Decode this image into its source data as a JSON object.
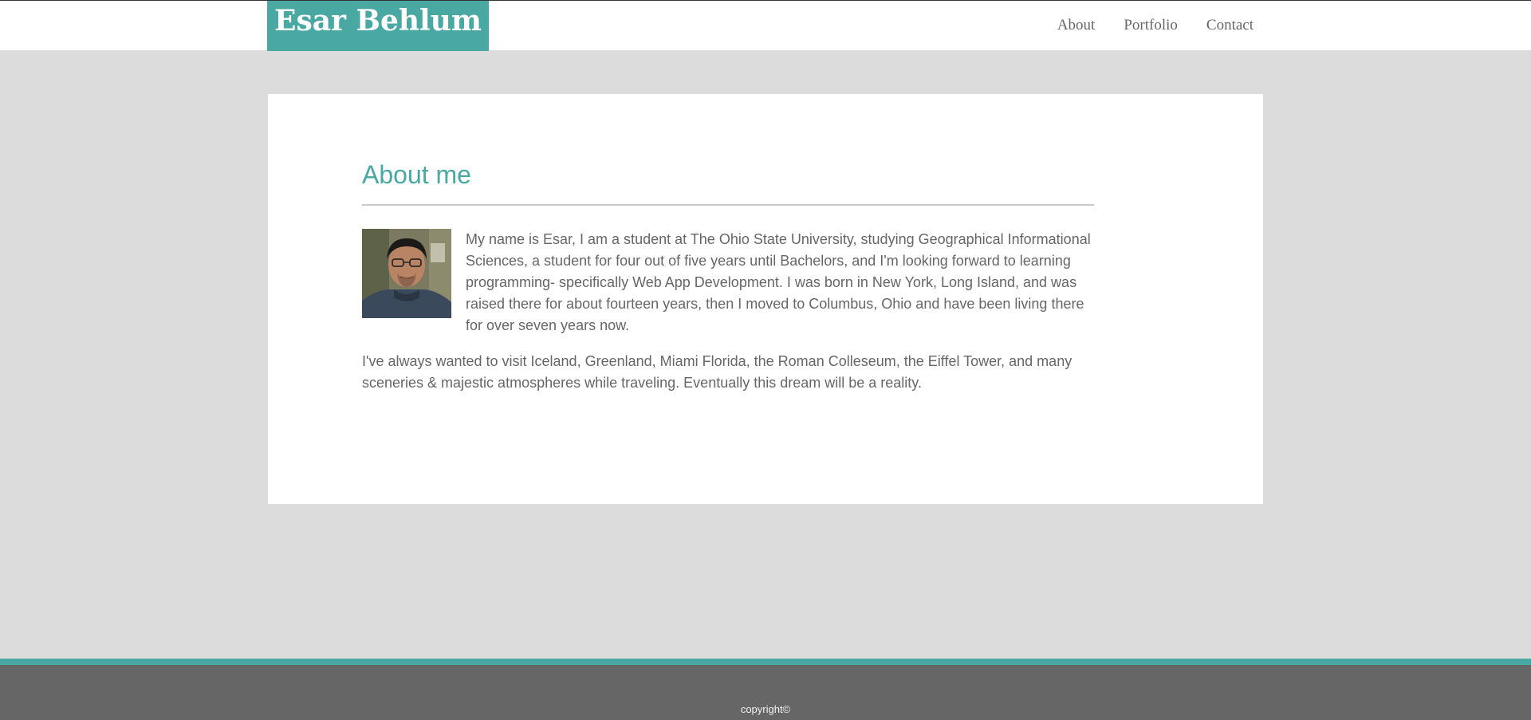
{
  "header": {
    "brand": "Esar Behlum",
    "nav": [
      "About",
      "Portfolio",
      "Contact"
    ]
  },
  "about": {
    "title": "About me",
    "paragraph1": "My name is Esar, I am a student at The Ohio State University, studying Geographical Informational Sciences, a student for four out of five years until Bachelors, and I'm looking forward to learning programming- specifically Web App Development. I was born in New York, Long Island, and was raised there for about fourteen years, then I moved to Columbus, Ohio and have been living there for over seven years now.",
    "paragraph2": "I've always wanted to visit Iceland, Greenland, Miami Florida, the Roman Colleseum, the Eiffel Tower, and many sceneries & majestic atmospheres while traveling. Eventually this dream will be a reality."
  },
  "footer": {
    "copyright": "copyright©"
  },
  "colors": {
    "accent": "#4aa8a3",
    "background": "#dcdcdc",
    "footer": "#666666",
    "text": "#666666"
  }
}
